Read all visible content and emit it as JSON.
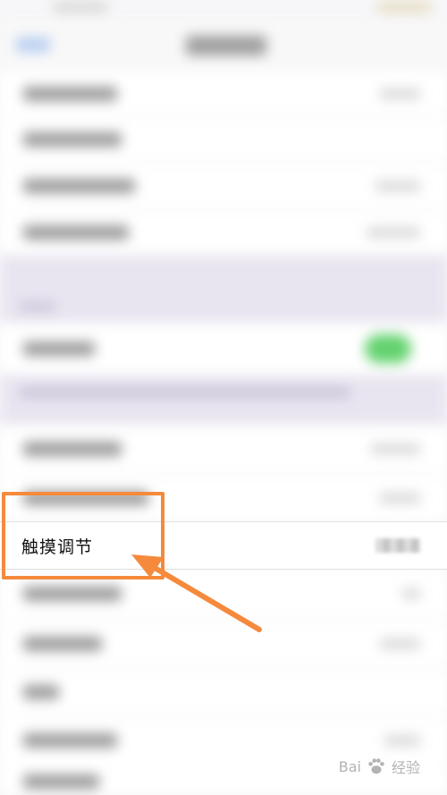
{
  "highlighted_row": {
    "label": "触摸调节"
  },
  "watermark": {
    "text_left": "Bai",
    "text_right": "经验",
    "icon": "paw-icon"
  },
  "colors": {
    "highlight": "#f58a3c",
    "toggle_on": "#63d26e",
    "section_tint": "#e9e5f0"
  }
}
